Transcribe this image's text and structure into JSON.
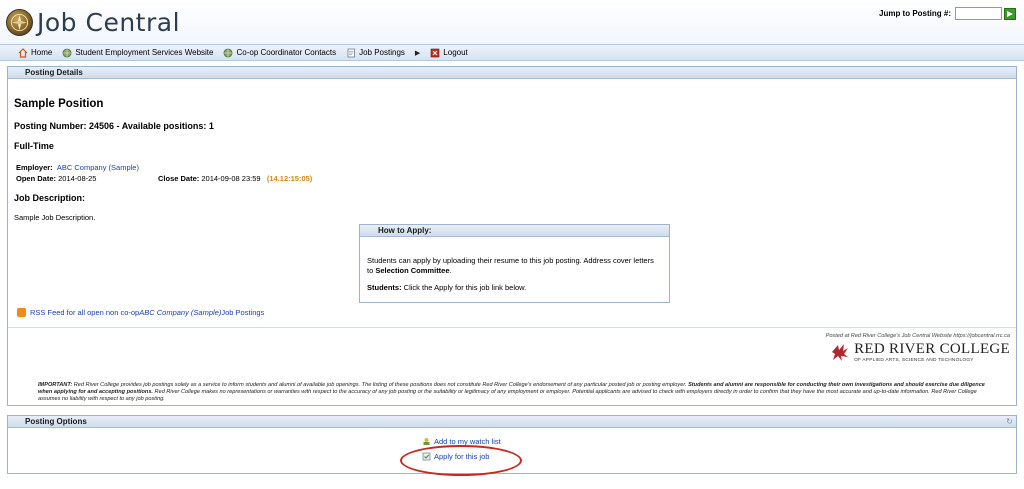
{
  "header": {
    "app_title": "Job Central",
    "jump_label": "Jump to Posting #:",
    "jump_value": ""
  },
  "nav": {
    "items": [
      {
        "label": "Home",
        "icon": "home-icon"
      },
      {
        "label": "Student Employment Services Website",
        "icon": "globe-icon"
      },
      {
        "label": "Co-op Coordinator Contacts",
        "icon": "globe-icon"
      },
      {
        "label": "Job Postings",
        "icon": "document-icon"
      },
      {
        "label": "Logout",
        "icon": "logout-icon"
      }
    ]
  },
  "details": {
    "panel_title": "Posting Details",
    "position_title": "Sample Position",
    "posting_number_line": "Posting Number: 24506 - Available positions: 1",
    "job_type": "Full-Time",
    "employer_label": "Employer:",
    "employer_name": "ABC Company (Sample)",
    "open_date_label": "Open Date:",
    "open_date": "2014-08-25",
    "close_date_label": "Close Date:",
    "close_date": "2014-09-08 23:59",
    "countdown": "(14.12:15:05)",
    "job_description_heading": "Job Description:",
    "job_description": "Sample Job Description.",
    "how_to_apply": {
      "title": "How to Apply:",
      "text_a": "Students can apply by uploading their resume to this job posting. Address cover letters to ",
      "text_b": "Selection Committee",
      "text_c": ".",
      "students_label": "Students:",
      "students_text": " Click the Apply for this job link below."
    },
    "rss": {
      "prefix": "RSS Feed for all open non co-op ",
      "company": "ABC Company (Sample)",
      "suffix": " Job Postings"
    },
    "posted_at": "Posted at Red River College's Job Central Website https://jobcentral.rrc.ca",
    "college_name": "RED RIVER COLLEGE",
    "college_subtitle": "OF APPLIED ARTS, SCIENCE AND TECHNOLOGY",
    "disclaimer": {
      "label": "IMPORTANT:",
      "text_a": " Red River College provides job postings solely as a service to inform students and alumni of available job openings. The listing of these positions does not constitute Red River College's endorsement of any particular posted job or posting employer. ",
      "text_b": "Students and alumni are responsible for conducting their own investigations and should exercise due diligence when applying for and accepting positions.",
      "text_c": " Red River College makes no representations or warranties with respect to the accuracy of any job posting or the suitability or legitimacy of any employment or employer. Potential applicants are advised to check with employers directly in order to confirm that they have the most accurate and up-to-date information. Red River College assumes no liability with respect to any job posting."
    }
  },
  "options": {
    "panel_title": "Posting Options",
    "watch_label": "Add to my watch list",
    "apply_label": "Apply for this job"
  },
  "colors": {
    "link": "#1a3fb0",
    "countdown": "#d08a14",
    "annotation": "#c8281e"
  }
}
